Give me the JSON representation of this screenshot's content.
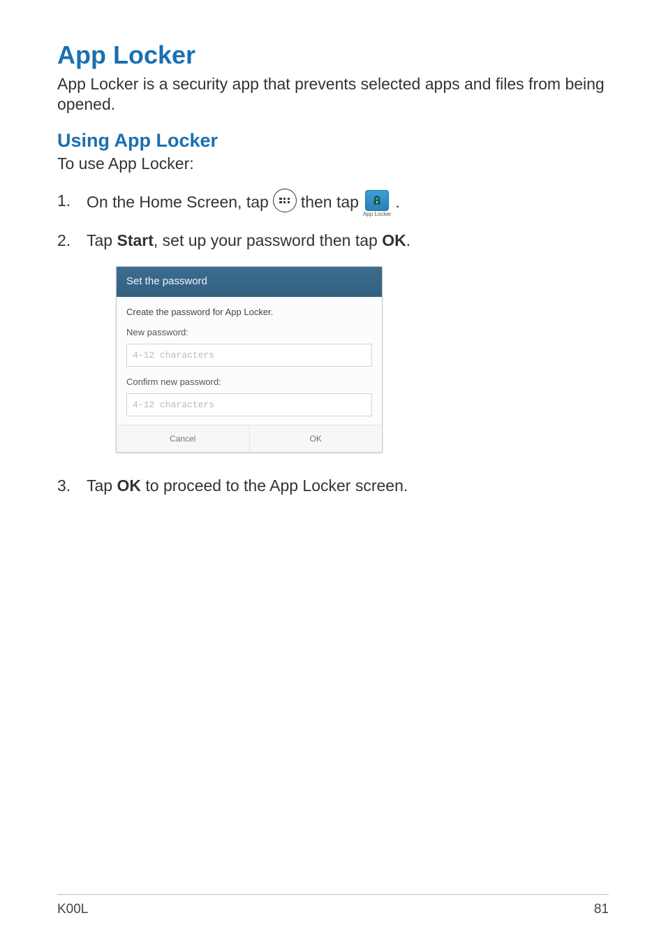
{
  "headings": {
    "h1": "App Locker",
    "h2": "Using App Locker"
  },
  "intro": "App Locker is a security app that prevents selected apps and files from being opened.",
  "lead": "To use App Locker:",
  "steps": {
    "s1_a": "On the Home Screen, tap",
    "s1_b": "then tap",
    "s1_end": ".",
    "s2_a": "Tap ",
    "s2_start": "Start",
    "s2_b": ", set up your password then tap ",
    "s2_ok": "OK",
    "s2_end": ".",
    "s3_a": "Tap ",
    "s3_ok": "OK",
    "s3_b": " to proceed to the App Locker screen."
  },
  "locker_icon_label": "App Locker",
  "dialog": {
    "title": "Set the password",
    "desc": "Create the password for App Locker.",
    "new_pw_label": "New password:",
    "confirm_label": "Confirm new password:",
    "placeholder": "4-12 characters",
    "cancel": "Cancel",
    "ok": "OK"
  },
  "footer": {
    "model": "K00L",
    "page": "81"
  }
}
